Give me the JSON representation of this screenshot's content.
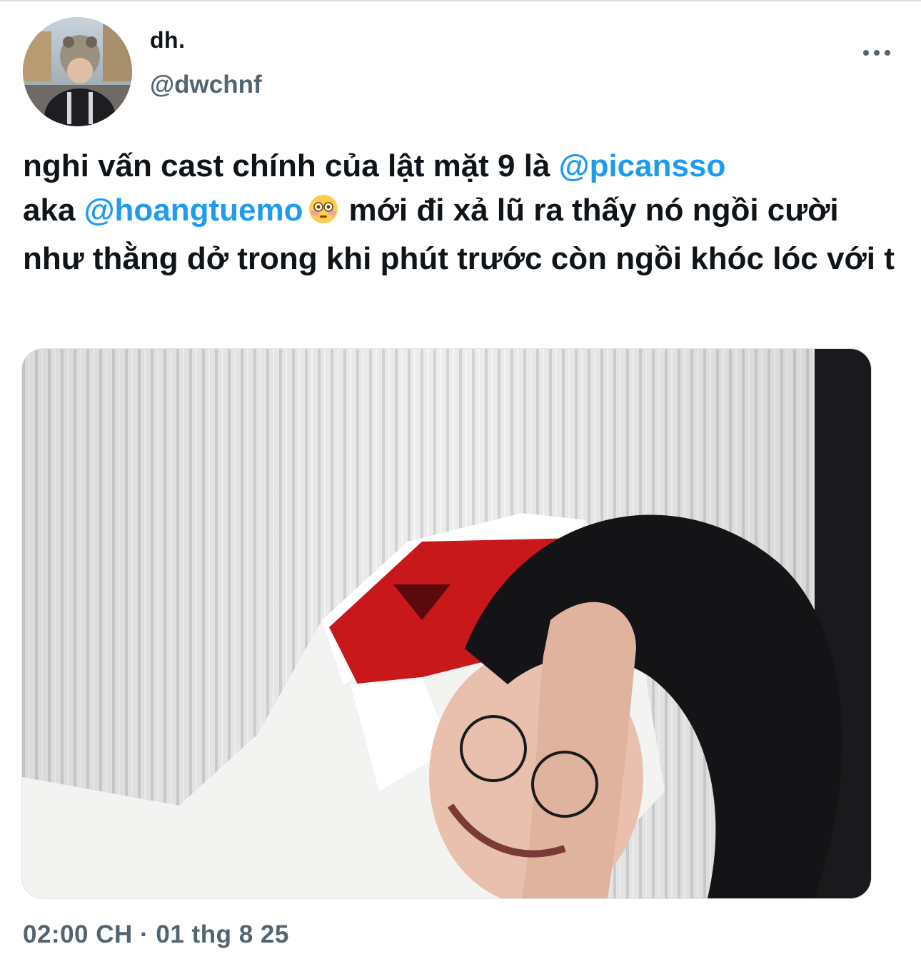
{
  "tweet": {
    "author": {
      "display_name": "dh.",
      "handle": "@dwchnf"
    },
    "more_icon": "more-horizontal-icon",
    "text": {
      "line1_prefix": "nghi vấn cast chính của lật mặt 9 là ",
      "mention1": "@picansso",
      "line2_prefix": "aka ",
      "mention2": "@hoangtuemo",
      "emoji": "😳",
      "rest": "mới đi xả lũ ra thấy nó ngồi cười như thằng dở trong khi phút trước còn ngồi khóc lóc với t"
    },
    "timestamp": "02:00 CH · 01 thg 8 25",
    "colors": {
      "mention": "#1d9bf0",
      "secondary_text": "#536471",
      "primary_text": "#0f1419"
    }
  }
}
